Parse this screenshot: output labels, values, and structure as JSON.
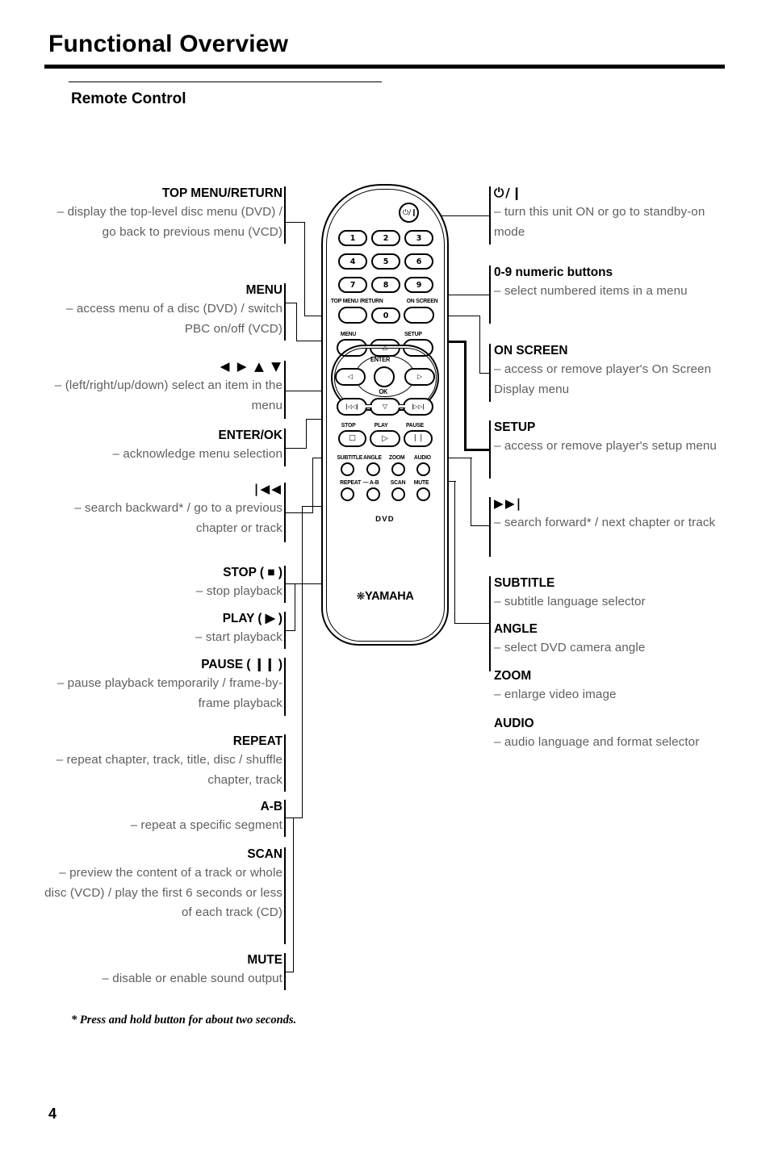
{
  "header": {
    "title": "Functional Overview",
    "section_title": "Remote Control"
  },
  "left_callouts": [
    {
      "id": "top-menu-return",
      "heading": "TOP MENU/RETURN",
      "description": "– display the top-level disc menu (DVD) / go back to previous menu (VCD)"
    },
    {
      "id": "menu",
      "heading": "MENU",
      "description": "– access menu of a disc (DVD) / switch PBC on/off (VCD)"
    },
    {
      "id": "cursor-keys",
      "heading": "◀ ▶  ▲ ▼",
      "description": "– (left/right/up/down) select an item in the menu"
    },
    {
      "id": "enter-ok",
      "heading": "ENTER/OK",
      "description": "– acknowledge menu selection"
    },
    {
      "id": "search-backward",
      "heading": "|◀◀",
      "description": "– search backward* / go to a previous chapter or track"
    },
    {
      "id": "stop",
      "heading": "STOP ( ■ )",
      "description": "– stop playback"
    },
    {
      "id": "play",
      "heading": "PLAY ( ▶ )",
      "description": "– start playback"
    },
    {
      "id": "pause",
      "heading": "PAUSE ( ❙❙ )",
      "description": "– pause playback temporarily / frame-by-frame playback"
    },
    {
      "id": "repeat",
      "heading": "REPEAT",
      "description": "– repeat chapter, track, title, disc / shuffle chapter, track"
    },
    {
      "id": "a-b",
      "heading": "A-B",
      "description": "– repeat a specific segment"
    },
    {
      "id": "scan",
      "heading": "SCAN",
      "description": "– preview the content of a track or whole disc (VCD) / play the first 6 seconds or less of each track (CD)"
    },
    {
      "id": "mute",
      "heading": "MUTE",
      "description": "– disable or enable sound output"
    }
  ],
  "right_callouts": [
    {
      "id": "power",
      "heading": "⏻/❙",
      "description": "– turn this unit ON or go to standby-on mode"
    },
    {
      "id": "numeric-buttons",
      "heading": "0-9 numeric buttons",
      "description": "– select numbered items in a menu"
    },
    {
      "id": "on-screen",
      "heading": "ON SCREEN",
      "description": "– access or remove player's On Screen Display menu"
    },
    {
      "id": "setup",
      "heading": "SETUP",
      "description": "– access or remove player's setup menu"
    },
    {
      "id": "search-forward",
      "heading": "▶▶|",
      "description": "– search forward* / next chapter or track"
    },
    {
      "id": "subtitle",
      "heading": "SUBTITLE",
      "description": "– subtitle language selector"
    },
    {
      "id": "angle",
      "heading": "ANGLE",
      "description": "– select DVD camera angle"
    },
    {
      "id": "zoom",
      "heading": "ZOOM",
      "description": "– enlarge video image"
    },
    {
      "id": "audio",
      "heading": "AUDIO",
      "description": "– audio language and format selector"
    }
  ],
  "remote": {
    "brand": "YAMAHA",
    "media_label": "DVD",
    "power_icon": "⏻/❙",
    "numeric_keys": [
      "1",
      "2",
      "3",
      "4",
      "5",
      "6",
      "7",
      "8",
      "9",
      "0"
    ],
    "labels": {
      "top_menu_return": "TOP MENU /RETURN",
      "on_screen": "ON SCREEN",
      "menu": "MENU",
      "setup": "SETUP",
      "enter": "ENTER",
      "ok": "OK",
      "stop": "STOP",
      "play": "PLAY",
      "pause": "PAUSE",
      "subtitle": "SUBTITLE",
      "angle": "ANGLE",
      "zoom": "ZOOM",
      "audio": "AUDIO",
      "repeat": "REPEAT",
      "repeat_ab": "— A-B",
      "scan": "SCAN",
      "mute": "MUTE"
    },
    "glyphs": {
      "up": "△",
      "down": "▽",
      "left": "◁",
      "right": "▷",
      "prev": "|◁◁|",
      "next": "|▷▷|",
      "stop": "□",
      "play": "▷",
      "pause": "❘❘"
    }
  },
  "footnote": "* Press and hold button for about two seconds.",
  "page_number": "4",
  "colors": {
    "ink": "#000000",
    "description_gray": "#5f5f5f",
    "paper": "#ffffff"
  }
}
